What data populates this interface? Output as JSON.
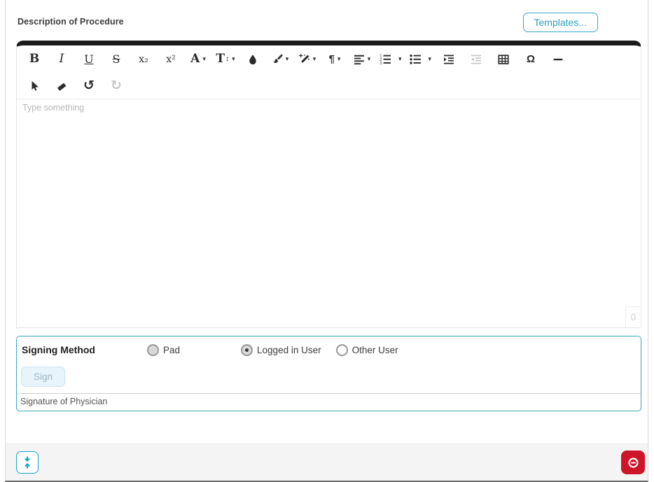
{
  "colors": {
    "accent": "#2D9FC2",
    "accent_bright": "#00A7CB",
    "danger": "#CD1428",
    "toolbar_icon": "#2B2B2B",
    "disabled_icon": "#C7C7C7",
    "editor_topbar": "#1B1B1B"
  },
  "header": {
    "title": "Description of Procedure",
    "templates_button_label": "Templates..."
  },
  "editor": {
    "placeholder": "Type something",
    "char_count": "0",
    "toolbar_rows": [
      {
        "name": "toolbar-row-1",
        "items": [
          {
            "name": "bold-button",
            "glyph": "B",
            "style": "serif-bold"
          },
          {
            "name": "italic-button",
            "glyph": "I",
            "style": "serif-italic"
          },
          {
            "name": "underline-button",
            "glyph": "U",
            "style": "serif-underline"
          },
          {
            "name": "strikethrough-button",
            "glyph": "S",
            "style": "serif-strike"
          },
          {
            "name": "subscript-button",
            "glyph": "x₂",
            "style": "serif-small"
          },
          {
            "name": "superscript-button",
            "glyph": "x²",
            "style": "serif-small"
          },
          {
            "name": "font-family-button",
            "glyph": "A",
            "style": "serif-bold",
            "caret": true
          },
          {
            "name": "font-size-button",
            "glyph": "T",
            "glyph2": "↕",
            "style": "serif-bold",
            "caret": true
          },
          {
            "name": "text-color-button",
            "icon": "droplet-icon"
          },
          {
            "name": "highlight-color-button",
            "icon": "brush-icon",
            "caret": true
          },
          {
            "name": "inline-style-button",
            "icon": "wand-icon",
            "caret": true
          },
          {
            "name": "paragraph-format-button",
            "glyph": "¶",
            "style": "sans-bold",
            "caret": true
          },
          {
            "name": "align-button",
            "icon": "align-left-icon",
            "caret": true
          },
          {
            "name": "ordered-list-button",
            "icon": "ordered-list-icon",
            "caret": true,
            "gap": true
          },
          {
            "name": "unordered-list-button",
            "icon": "unordered-list-icon",
            "caret": true,
            "gap": true
          },
          {
            "name": "indent-button",
            "icon": "indent-icon"
          },
          {
            "name": "outdent-button",
            "icon": "outdent-icon",
            "disabled": true
          },
          {
            "name": "insert-table-button",
            "icon": "table-icon"
          },
          {
            "name": "special-characters-button",
            "glyph": "Ω",
            "style": "sans-bold"
          },
          {
            "name": "horizontal-line-button",
            "icon": "hline-icon"
          }
        ]
      },
      {
        "name": "toolbar-row-2",
        "items": [
          {
            "name": "select-tool-button",
            "icon": "cursor-icon"
          },
          {
            "name": "eraser-button",
            "icon": "eraser-icon"
          },
          {
            "name": "undo-button",
            "glyph": "↺",
            "style": "arrow"
          },
          {
            "name": "redo-button",
            "glyph": "↻",
            "style": "arrow",
            "disabled": true
          }
        ]
      }
    ]
  },
  "signing": {
    "label": "Signing Method",
    "options": [
      {
        "label": "Pad",
        "state": "unselected-filled"
      },
      {
        "label": "Logged in User",
        "state": "selected"
      },
      {
        "label": "Other User",
        "state": "unselected"
      }
    ],
    "sign_button_label": "Sign",
    "signature_label": "Signature of Physician"
  },
  "footer": {
    "collapse_button_icon": "collapse-vertical-icon",
    "remove_button_icon": "minus-circle-icon"
  }
}
